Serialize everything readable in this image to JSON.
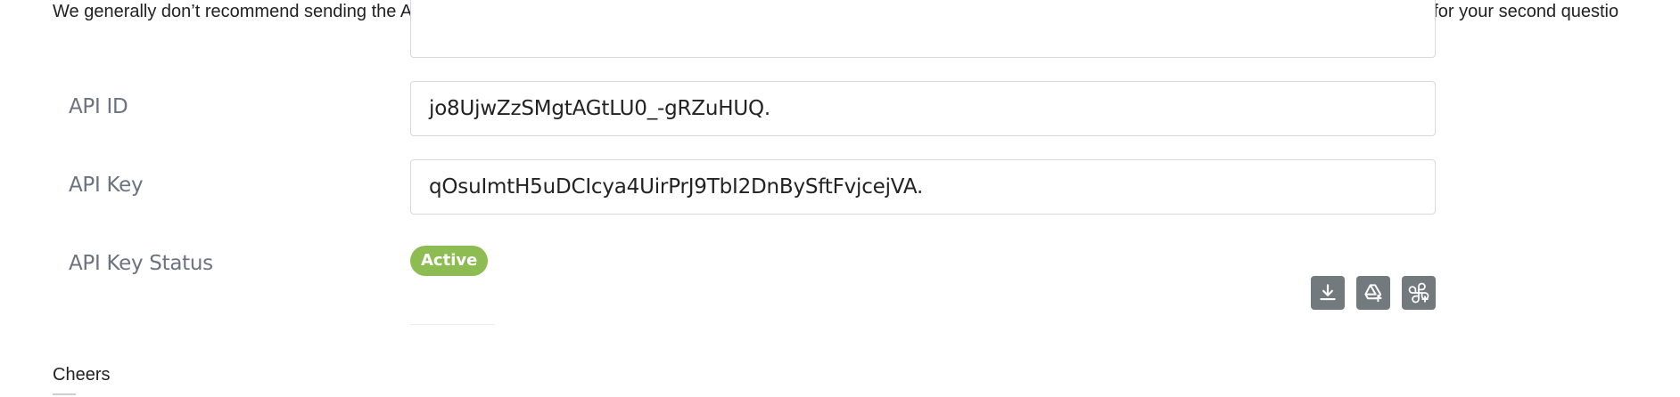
{
  "email": {
    "intro_text": "We generally don’t recommend sending the API keys over email for security reasons but I have included it as a screenshot for you; I will contact engineering to get you a script for your second questio",
    "closing": "Cheers"
  },
  "screenshot": {
    "fields": [
      {
        "label": "API ID",
        "value": "jo8UjwZzSMgtAGtLU0_-gRZuHUQ."
      },
      {
        "label": "API Key",
        "value": "qOsuImtH5uDCIcya4UirPrJ9TbI2DnBySftFvjcejVA."
      }
    ],
    "status": {
      "label": "API Key Status",
      "badge": "Active",
      "badge_color": "#8dbd52"
    },
    "toolbar_icons": [
      "download-icon",
      "drive-add-icon",
      "pinwheel-add-icon"
    ]
  }
}
